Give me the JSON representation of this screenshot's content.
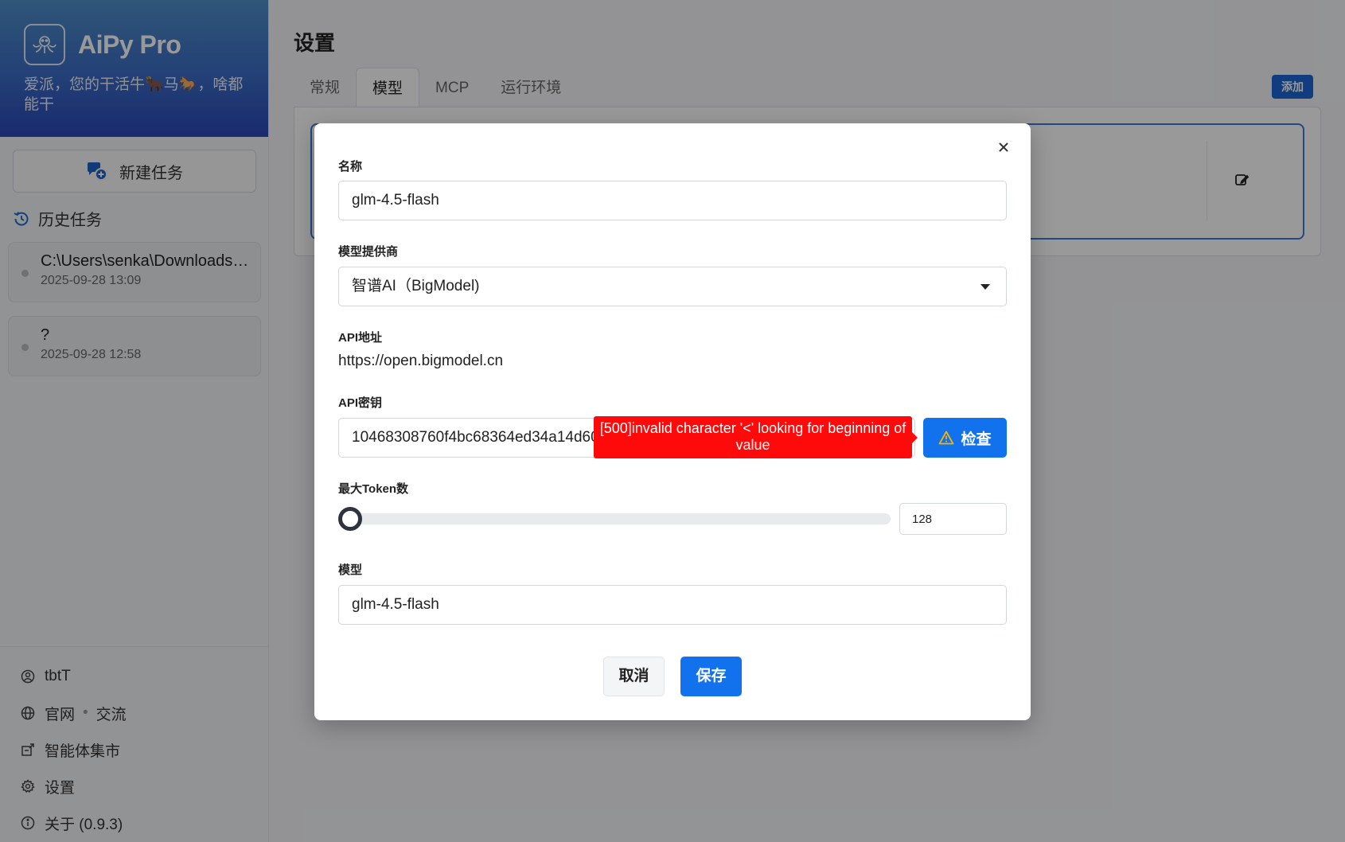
{
  "sidebar": {
    "brand_name": "AiPy Pro",
    "slogan": "爱派，您的干活牛🐂马🐎，啥都能干",
    "new_task_label": "新建任务",
    "history_label": "历史任务",
    "tasks": [
      {
        "title": "C:\\Users\\senka\\Downloads\\...",
        "date": "2025-09-28 13:09"
      },
      {
        "title": "?",
        "date": "2025-09-28 12:58"
      }
    ],
    "footer": {
      "user": "tbtT",
      "website": "官网",
      "community": "交流",
      "market": "智能体集市",
      "settings": "设置",
      "about": "关于 (0.9.3)"
    }
  },
  "main": {
    "title": "设置",
    "tabs": [
      {
        "label": "常规",
        "active": false
      },
      {
        "label": "模型",
        "active": true
      },
      {
        "label": "MCP",
        "active": false
      },
      {
        "label": "运行环境",
        "active": false
      }
    ],
    "add_label": "添加"
  },
  "modal": {
    "name_label": "名称",
    "name_value": "glm-4.5-flash",
    "provider_label": "模型提供商",
    "provider_value": "智谱AI（BigModel)",
    "api_url_label": "API地址",
    "api_url_value": "https://open.bigmodel.cn",
    "api_key_label": "API密钥",
    "api_key_value": "10468308760f4bc68364ed34a14d60",
    "error_tooltip": "[500]invalid character '<' looking for beginning of value",
    "check_label": "检查",
    "max_token_label": "最大Token数",
    "max_token_value": "128",
    "max_token_fraction": 0,
    "model_label": "模型",
    "model_value": "glm-4.5-flash",
    "cancel_label": "取消",
    "save_label": "保存"
  },
  "colors": {
    "primary": "#1272ee",
    "error": "#ff0a0a",
    "brand_gradient_top": "#4f8fc8",
    "brand_gradient_bottom": "#2a47b8"
  },
  "icons": {
    "logo": "octopus-logo-icon",
    "new_task": "chat-plus-icon",
    "history": "history-icon",
    "user": "user-circle-icon",
    "website": "globe-icon",
    "market": "store-icon",
    "settings": "gear-icon",
    "about": "info-icon",
    "edit": "edit-icon",
    "close": "close-icon",
    "warning": "warning-icon",
    "dropdown": "caret-down-icon"
  }
}
